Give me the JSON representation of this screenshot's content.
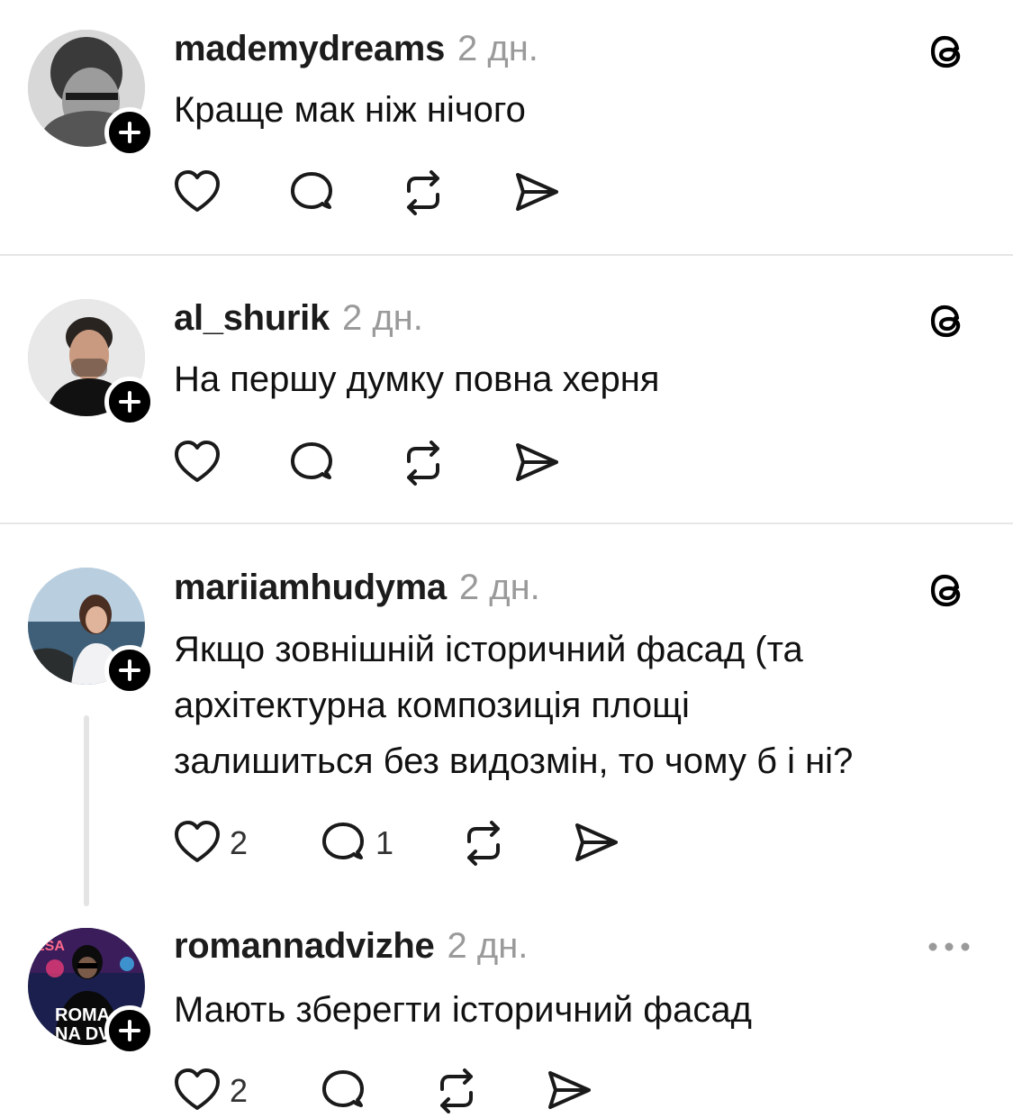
{
  "posts": [
    {
      "username": "mademydreams",
      "time": "2 дн.",
      "text": "Краще мак ніж нічого",
      "likes": "",
      "replies": ""
    },
    {
      "username": "al_shurik",
      "time": "2 дн.",
      "text": "На першу думку повна херня",
      "likes": "",
      "replies": ""
    },
    {
      "username": "mariiamhudyma",
      "time": "2 дн.",
      "text_lines": [
        "Якщо зовнішній історичний фасад (та",
        "архітектурна композиція площі",
        "залишиться без видозмін, то чому б і ні?"
      ],
      "likes": "2",
      "replies": "1"
    },
    {
      "username": "romannadvizhe",
      "time": "2 дн.",
      "text": "Мають зберегти історичний фасад",
      "likes": "2",
      "replies": "",
      "avatar_text_top": "ROMA",
      "avatar_text_bottom": "NA DV",
      "avatar_text_corner": "ESA"
    }
  ],
  "icons": {
    "like": "heart-icon",
    "reply": "comment-icon",
    "repost": "repost-icon",
    "share": "send-icon",
    "threads": "threads-logo-icon",
    "more": "more-dots-icon",
    "follow": "plus-icon"
  },
  "colors": {
    "text": "#000000",
    "muted": "#9a9a9a",
    "divider": "#e6e6e6"
  }
}
